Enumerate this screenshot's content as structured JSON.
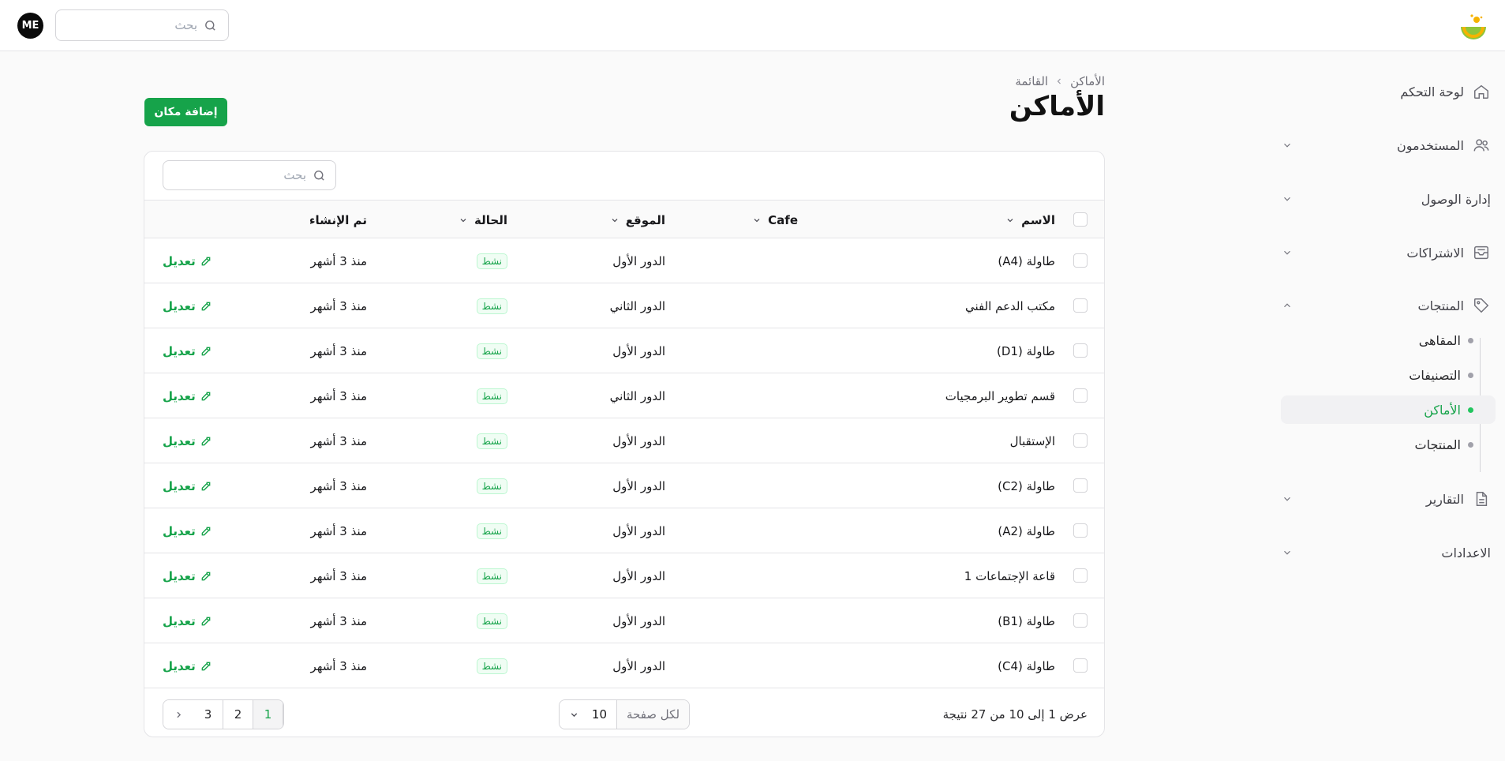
{
  "topbar": {
    "avatar_initials": "ME",
    "search_placeholder": "بحث"
  },
  "sidebar": {
    "items": [
      {
        "label": "لوحة التحكم",
        "icon": "home-icon"
      },
      {
        "label": "المستخدمون",
        "icon": "users-icon"
      },
      {
        "label": "إدارة الوصول",
        "icon": ""
      },
      {
        "label": "الاشتراكات",
        "icon": "inbox-icon"
      },
      {
        "label": "المنتجات",
        "icon": "tag-icon"
      },
      {
        "label": "التقارير",
        "icon": "document-icon"
      },
      {
        "label": "الاعدادات",
        "icon": ""
      }
    ],
    "subitems": [
      {
        "label": "المقاهى"
      },
      {
        "label": "التصنيفات"
      },
      {
        "label": "الأماكن",
        "active": true
      },
      {
        "label": "المنتجات"
      }
    ]
  },
  "main": {
    "breadcrumb": [
      "الأماكن",
      "القائمة"
    ],
    "title": "الأماكن",
    "add_button": "إضافة مكان",
    "table_search_placeholder": "بحث",
    "columns": {
      "name": "الاسم",
      "cafe": "Cafe",
      "location": "الموقع",
      "status": "الحالة",
      "created": "تم الإنشاء"
    },
    "edit_label": "تعديل",
    "rows": [
      {
        "name": "طاولة (A4)",
        "location": "الدور الأول",
        "status": "نشط",
        "created": "منذ 3 أشهر"
      },
      {
        "name": "مكتب الدعم الفني",
        "location": "الدور الثاني",
        "status": "نشط",
        "created": "منذ 3 أشهر"
      },
      {
        "name": "طاولة (D1)",
        "location": "الدور الأول",
        "status": "نشط",
        "created": "منذ 3 أشهر"
      },
      {
        "name": "قسم تطوير البرمجيات",
        "location": "الدور الثاني",
        "status": "نشط",
        "created": "منذ 3 أشهر"
      },
      {
        "name": "الإستقبال",
        "location": "الدور الأول",
        "status": "نشط",
        "created": "منذ 3 أشهر"
      },
      {
        "name": "طاولة (C2)",
        "location": "الدور الأول",
        "status": "نشط",
        "created": "منذ 3 أشهر"
      },
      {
        "name": "طاولة (A2)",
        "location": "الدور الأول",
        "status": "نشط",
        "created": "منذ 3 أشهر"
      },
      {
        "name": "قاعة الإجتماعات 1",
        "location": "الدور الأول",
        "status": "نشط",
        "created": "منذ 3 أشهر"
      },
      {
        "name": "طاولة (B1)",
        "location": "الدور الأول",
        "status": "نشط",
        "created": "منذ 3 أشهر"
      },
      {
        "name": "طاولة (C4)",
        "location": "الدور الأول",
        "status": "نشط",
        "created": "منذ 3 أشهر"
      }
    ],
    "footer": {
      "results_text": "عرض 1 إلى 10 من 27 نتيجة",
      "per_page_label": "لكل صفحة",
      "per_page_value": "10",
      "pages": [
        "1",
        "2",
        "3"
      ],
      "current_page": "1"
    }
  },
  "colors": {
    "accent": "#16a34a",
    "background": "#fafafa",
    "border": "#e4e4e7"
  }
}
